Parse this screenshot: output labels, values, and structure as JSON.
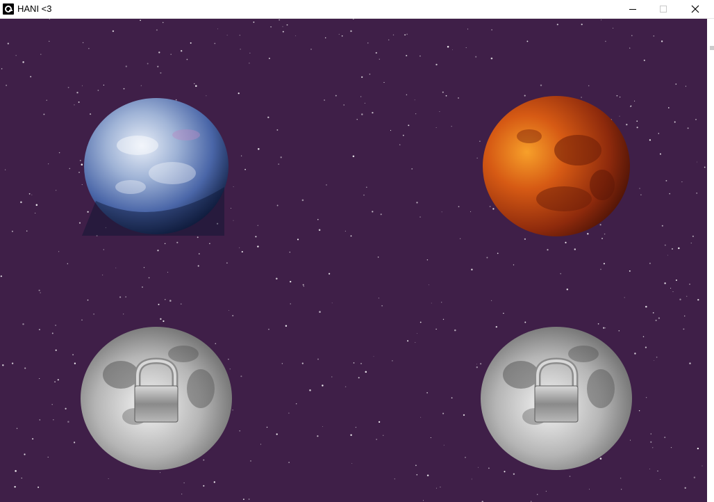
{
  "window": {
    "title": "HANI <3",
    "icon": "app-logo-icon",
    "controls": [
      "minimize-icon",
      "maximize-icon",
      "close-icon"
    ]
  },
  "scene": {
    "background_color": "#3f1f48",
    "planets": [
      {
        "name": "earth",
        "locked": false
      },
      {
        "name": "mars",
        "locked": false
      },
      {
        "name": "moon",
        "locked": true
      },
      {
        "name": "moon",
        "locked": true
      }
    ]
  }
}
